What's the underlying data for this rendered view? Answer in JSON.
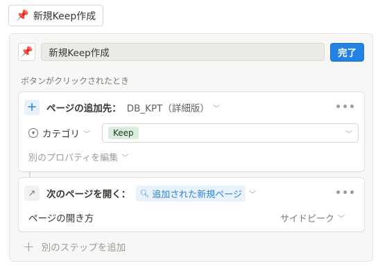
{
  "top_button": {
    "icon": "pushpin-icon",
    "emoji": "📌",
    "label": "新規Keep作成"
  },
  "editor": {
    "icon_emoji": "📌",
    "name_value": "新規Keep作成",
    "done_label": "完了",
    "trigger_label": "ボタンがクリックされたとき"
  },
  "step1": {
    "action_label": "ページの追加先：",
    "database": "DB_KPT（詳細版）",
    "property_label": "カテゴリ",
    "property_value": "Keep",
    "edit_props_label": "別のプロパティを編集"
  },
  "step2": {
    "action_label": "次のページを開く：",
    "target": "追加された新規ページ",
    "open_mode_label": "ページの開き方",
    "open_mode_value": "サイドピーク"
  },
  "add_step_label": "別のステップを追加",
  "colors": {
    "accent": "#2383e2",
    "tag_bg": "#dbeddb",
    "panel_bg": "#f7f7f5"
  }
}
